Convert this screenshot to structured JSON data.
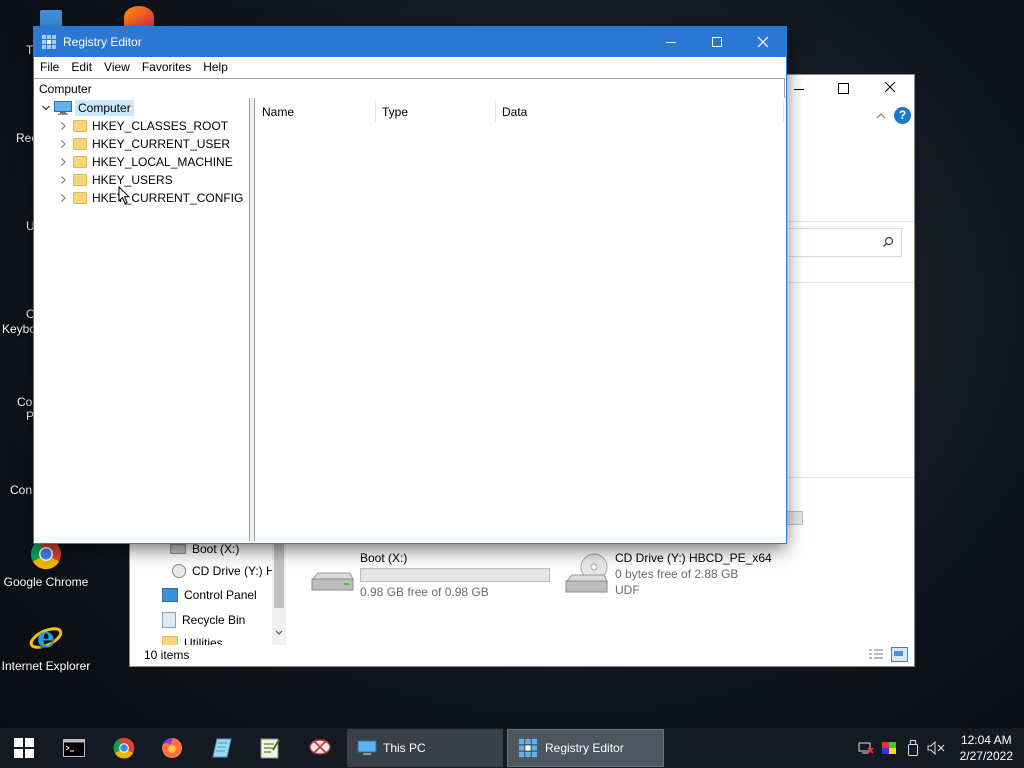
{
  "desktop": {
    "icons": [
      {
        "label": "Google Chrome"
      },
      {
        "label": "Internet Explorer"
      }
    ],
    "partial_labels": [
      "T",
      "Rec",
      "U",
      "C",
      "Keybo",
      "Co",
      "P",
      "Con"
    ]
  },
  "explorer": {
    "nav_items": [
      {
        "label": "Boot (X:)"
      },
      {
        "label": "CD Drive (Y:) H"
      },
      {
        "label": "Control Panel"
      },
      {
        "label": "Recycle Bin"
      },
      {
        "label": "Utilities"
      }
    ],
    "drives": [
      {
        "name": "Boot (X:)",
        "free": "0.98 GB free of 0.98 GB",
        "used_fraction": 0.0
      },
      {
        "name": "CD Drive (Y:) HBCD_PE_x64",
        "free": "0 bytes free of 2.88 GB",
        "fs": "UDF"
      }
    ],
    "status": "10 items",
    "colors": {
      "accent": "#0078d7"
    }
  },
  "regedit": {
    "title": "Registry Editor",
    "menu": [
      "File",
      "Edit",
      "View",
      "Favorites",
      "Help"
    ],
    "address": "Computer",
    "tree": {
      "root": "Computer",
      "children": [
        "HKEY_CLASSES_ROOT",
        "HKEY_CURRENT_USER",
        "HKEY_LOCAL_MACHINE",
        "HKEY_USERS",
        "HKEY_CURRENT_CONFIG"
      ]
    },
    "columns": [
      "Name",
      "Type",
      "Data"
    ],
    "colors": {
      "titlebar": "#2b78d4",
      "selection": "#cce8ff"
    }
  },
  "taskbar": {
    "tasks": [
      {
        "label": "This PC"
      },
      {
        "label": "Registry Editor"
      }
    ],
    "clock": {
      "time": "12:04 AM",
      "date": "2/27/2022"
    }
  }
}
